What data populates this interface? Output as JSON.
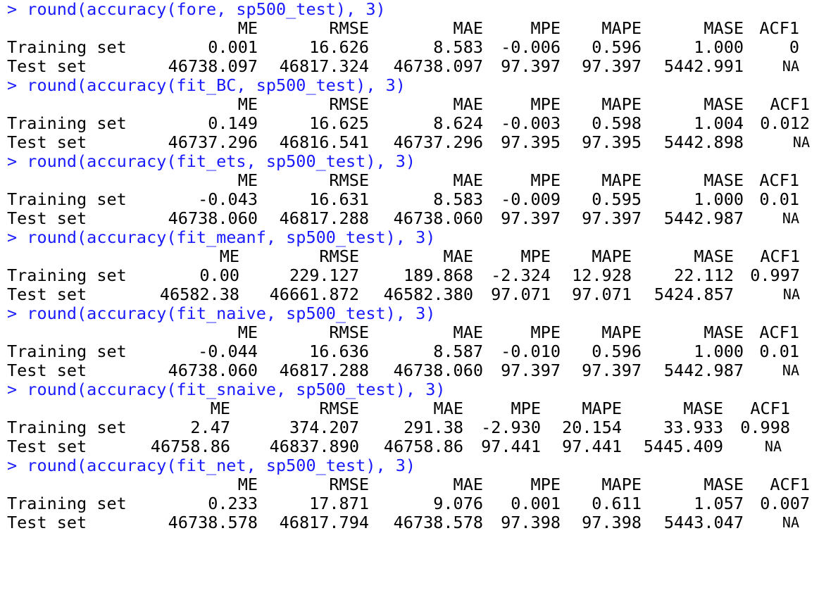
{
  "colors": {
    "command": "#1a1aff",
    "output": "#000000",
    "background": "#ffffff"
  },
  "prompt": ">",
  "row_labels": {
    "train": "Training set",
    "test": "Test set"
  },
  "blocks": [
    {
      "command": "> round(accuracy(fore, sp500_test), 3)",
      "headers": [
        "ME",
        "RMSE",
        "MAE",
        "MPE",
        "MAPE",
        "MASE",
        "ACF1"
      ],
      "train": [
        "0.001",
        "16.626",
        "8.583",
        "-0.006",
        "0.596",
        "1.000",
        "0"
      ],
      "test": [
        "46738.097",
        "46817.324",
        "46738.097",
        "97.397",
        "97.397",
        "5442.991",
        "NA"
      ]
    },
    {
      "command": "> round(accuracy(fit_BC, sp500_test), 3)",
      "headers": [
        "ME",
        "RMSE",
        "MAE",
        "MPE",
        "MAPE",
        "MASE",
        "ACF1"
      ],
      "train": [
        "0.149",
        "16.625",
        "8.624",
        "-0.003",
        "0.598",
        "1.004",
        "0.012"
      ],
      "test": [
        "46737.296",
        "46816.541",
        "46737.296",
        "97.395",
        "97.395",
        "5442.898",
        "NA"
      ]
    },
    {
      "command": "> round(accuracy(fit_ets, sp500_test), 3)",
      "headers": [
        "ME",
        "RMSE",
        "MAE",
        "MPE",
        "MAPE",
        "MASE",
        "ACF1"
      ],
      "train": [
        "-0.043",
        "16.631",
        "8.583",
        "-0.009",
        "0.595",
        "1.000",
        "0.01"
      ],
      "test": [
        "46738.060",
        "46817.288",
        "46738.060",
        "97.397",
        "97.397",
        "5442.987",
        "NA"
      ]
    },
    {
      "command": "> round(accuracy(fit_meanf, sp500_test), 3)",
      "headers": [
        "ME",
        "RMSE",
        "MAE",
        "MPE",
        "MAPE",
        "MASE",
        "ACF1"
      ],
      "train": [
        "0.00",
        "229.127",
        "189.868",
        "-2.324",
        "12.928",
        "22.112",
        "0.997"
      ],
      "test": [
        "46582.38",
        "46661.872",
        "46582.380",
        "97.071",
        "97.071",
        "5424.857",
        "NA"
      ]
    },
    {
      "command": "> round(accuracy(fit_naive, sp500_test), 3)",
      "headers": [
        "ME",
        "RMSE",
        "MAE",
        "MPE",
        "MAPE",
        "MASE",
        "ACF1"
      ],
      "train": [
        "-0.044",
        "16.636",
        "8.587",
        "-0.010",
        "0.596",
        "1.000",
        "0.01"
      ],
      "test": [
        "46738.060",
        "46817.288",
        "46738.060",
        "97.397",
        "97.397",
        "5442.987",
        "NA"
      ]
    },
    {
      "command": "> round(accuracy(fit_snaive, sp500_test), 3)",
      "headers": [
        "ME",
        "RMSE",
        "MAE",
        "MPE",
        "MAPE",
        "MASE",
        "ACF1"
      ],
      "train": [
        "2.47",
        "374.207",
        "291.38",
        "-2.930",
        "20.154",
        "33.933",
        "0.998"
      ],
      "test": [
        "46758.86",
        "46837.890",
        "46758.86",
        "97.441",
        "97.441",
        "5445.409",
        "NA"
      ]
    },
    {
      "command": "> round(accuracy(fit_net, sp500_test), 3)",
      "headers": [
        "ME",
        "RMSE",
        "MAE",
        "MPE",
        "MAPE",
        "MASE",
        "ACF1"
      ],
      "train": [
        "0.233",
        "17.871",
        "9.076",
        "0.001",
        "0.611",
        "1.057",
        "0.007"
      ],
      "test": [
        "46738.578",
        "46817.794",
        "46738.578",
        "97.398",
        "97.398",
        "5443.047",
        "NA"
      ]
    }
  ]
}
